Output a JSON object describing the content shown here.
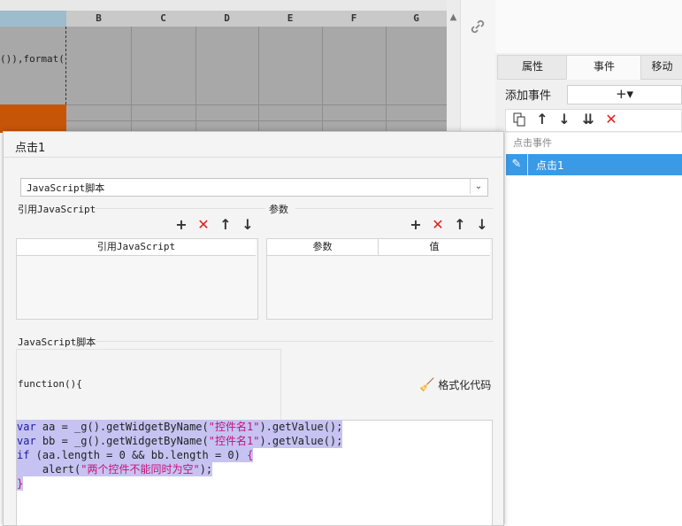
{
  "spreadsheet": {
    "columns": [
      "B",
      "C",
      "D",
      "E",
      "F",
      "G"
    ],
    "cell_text": "()),format("
  },
  "right_panel": {
    "tabs": [
      "属性",
      "事件",
      "移动"
    ],
    "add_event_label": "添加事件",
    "add_event_button": "+▾",
    "event_group_label": "点击事件",
    "event_item_label": "点击1"
  },
  "dialog": {
    "title": "点击1",
    "language_select": "JavaScript脚本",
    "ref_js_title": "引用JavaScript",
    "params_title": "参数",
    "ref_js_column": "引用JavaScript",
    "params_columns": [
      "参数",
      "值"
    ],
    "script_title": "JavaScript脚本",
    "function_signature": "function(){",
    "format_button": "格式化代码",
    "code": {
      "line1": {
        "kw": "var",
        "rest1": " aa = _g().getWidgetByName(",
        "str": "\"控件名1\"",
        "rest2": ").getValue();"
      },
      "line2": {
        "kw": "var",
        "rest1": " bb = _g().getWidgetByName(",
        "str": "\"控件名1\"",
        "rest2": ").getValue();"
      },
      "line3": {
        "kw": "if",
        "rest": " (aa.length = 0 && bb.length = 0) ",
        "brace": "{"
      },
      "line4": {
        "indent": "    alert(",
        "str": "\"两个控件不能同时为空\"",
        "rest": ");"
      },
      "line5": {
        "brace": "}"
      }
    }
  },
  "colors": {
    "accent_blue": "#3a9ae6",
    "delete_red": "#e02020",
    "orange_cell": "#c65508",
    "selection": "#c6c3f2"
  },
  "icons": [
    "link-icon",
    "copy-icon",
    "arrow-up-icon",
    "arrow-down-icon",
    "move-bottom-icon",
    "delete-icon",
    "edit-pencil-icon",
    "plus-icon",
    "chevron-down-icon",
    "broom-icon"
  ]
}
